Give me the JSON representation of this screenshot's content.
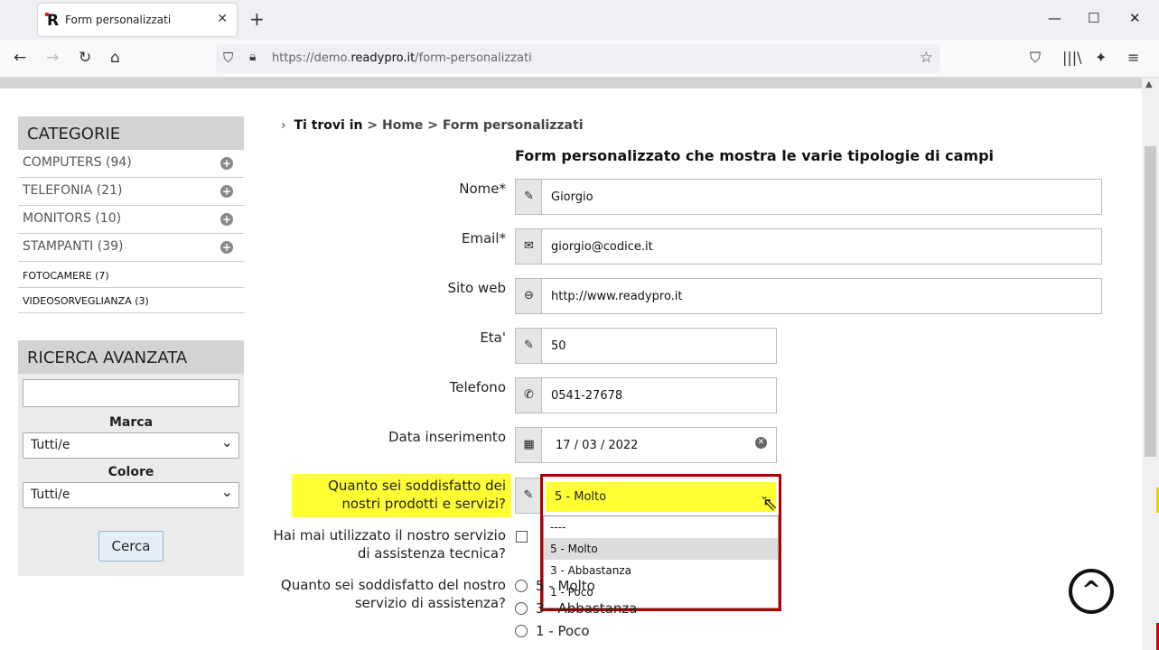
{
  "browser": {
    "tab_title": "Form personalizzati",
    "tab_logo": "R",
    "url_prefix": "https://demo.",
    "url_domain": "readypro.it",
    "url_path": "/form-personalizzati"
  },
  "sidebar": {
    "categories_title": "CATEGORIE",
    "categories": [
      {
        "label": "COMPUTERS (94)",
        "expandable": true
      },
      {
        "label": "TELEFONIA (21)",
        "expandable": true
      },
      {
        "label": "MONITORS (10)",
        "expandable": true
      },
      {
        "label": "STAMPANTI (39)",
        "expandable": true
      },
      {
        "label": "FOTOCAMERE (7)",
        "expandable": false
      },
      {
        "label": "VIDEOSORVEGLIANZA (3)",
        "expandable": false
      }
    ],
    "search_title": "RICERCA AVANZATA",
    "search_value": "",
    "brand_label": "Marca",
    "brand_value": "Tutti/e",
    "color_label": "Colore",
    "color_value": "Tutti/e",
    "search_button": "Cerca"
  },
  "breadcrumb": {
    "lead": "Ti trovi in",
    "home": "Home",
    "current": "Form personalizzati",
    "sep": ">"
  },
  "form": {
    "title": "Form personalizzato che mostra le varie tipologie di campi",
    "name_label": "Nome*",
    "name_value": "Giorgio",
    "email_label": "Email*",
    "email_value": "giorgio@codice.it",
    "website_label": "Sito web",
    "website_value": "http://www.readypro.it",
    "age_label": "Eta'",
    "age_value": "50",
    "phone_label": "Telefono",
    "phone_value": "0541-27678",
    "date_label": "Data inserimento",
    "date_value": "17 / 03 / 2022",
    "satisfaction_label": "Quanto sei soddisfatto dei nostri prodotti e servizi?",
    "satisfaction_selected": "5 - Molto",
    "satisfaction_options": [
      "----",
      "5 - Molto",
      "3 - Abbastanza",
      "1 - Poco"
    ],
    "assistance_used_label": "Hai mai utilizzato il nostro servizio di assistenza tecnica?",
    "assistance_satisfaction_label": "Quanto sei soddisfatto del nostro servizio di assistenza?",
    "assistance_options": [
      "5 - Molto",
      "3 - Abbastanza",
      "1 - Poco"
    ]
  },
  "icons": {
    "back": "←",
    "forward": "→",
    "reload": "↻",
    "home": "⌂",
    "pencil": "✎",
    "mail": "✉",
    "link": "⊖",
    "phone": "✆",
    "calendar": "▦",
    "to_top": "^"
  }
}
